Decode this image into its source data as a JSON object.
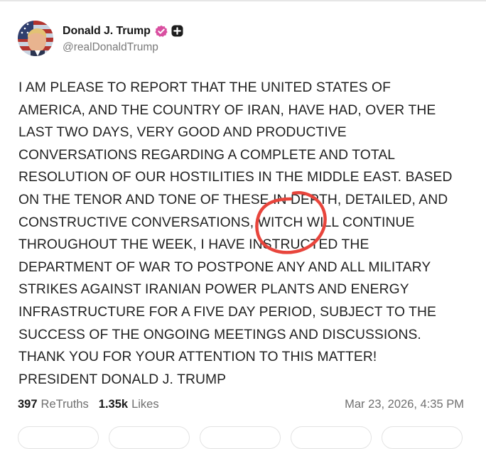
{
  "post": {
    "author_name": "Donald J. Trump",
    "author_handle": "@realDonaldTrump",
    "verified_icon": "verified-badge-icon",
    "plus_icon": "plus-badge-icon",
    "lines": [
      "I AM PLEASE TO REPORT THAT THE UNITED STATES OF",
      "AMERICA, AND THE COUNTRY OF IRAN, HAVE HAD, OVER THE",
      "LAST TWO DAYS, VERY GOOD AND PRODUCTIVE",
      "CONVERSATIONS REGARDING A COMPLETE AND TOTAL",
      "RESOLUTION OF OUR HOSTILITIES IN THE MIDDLE EAST. BASED",
      "ON THE TENOR AND TONE OF THESE IN DEPTH, DETAILED, AND",
      "CONSTRUCTIVE CONVERSATIONS, WITCH WILL CONTINUE",
      "THROUGHOUT THE WEEK, I HAVE INSTRUCTED THE",
      "DEPARTMENT OF WAR TO POSTPONE ANY AND ALL MILITARY",
      "STRIKES AGAINST IRANIAN POWER PLANTS AND ENERGY",
      "INFRASTRUCTURE FOR A FIVE DAY PERIOD, SUBJECT TO THE",
      "SUCCESS OF THE ONGOING MEETINGS AND DISCUSSIONS.",
      "THANK YOU FOR YOUR ATTENTION TO THIS MATTER!",
      "PRESIDENT DONALD J. TRUMP"
    ],
    "retruths_count": "397",
    "retruths_label": "ReTruths",
    "likes_count": "1.35k",
    "likes_label": "Likes",
    "timestamp": "Mar 23, 2026, 4:35 PM"
  },
  "colors": {
    "verified_badge": "#d94fa0",
    "circle_mark": "#e8453c",
    "text": "#222222",
    "muted": "#707070"
  }
}
